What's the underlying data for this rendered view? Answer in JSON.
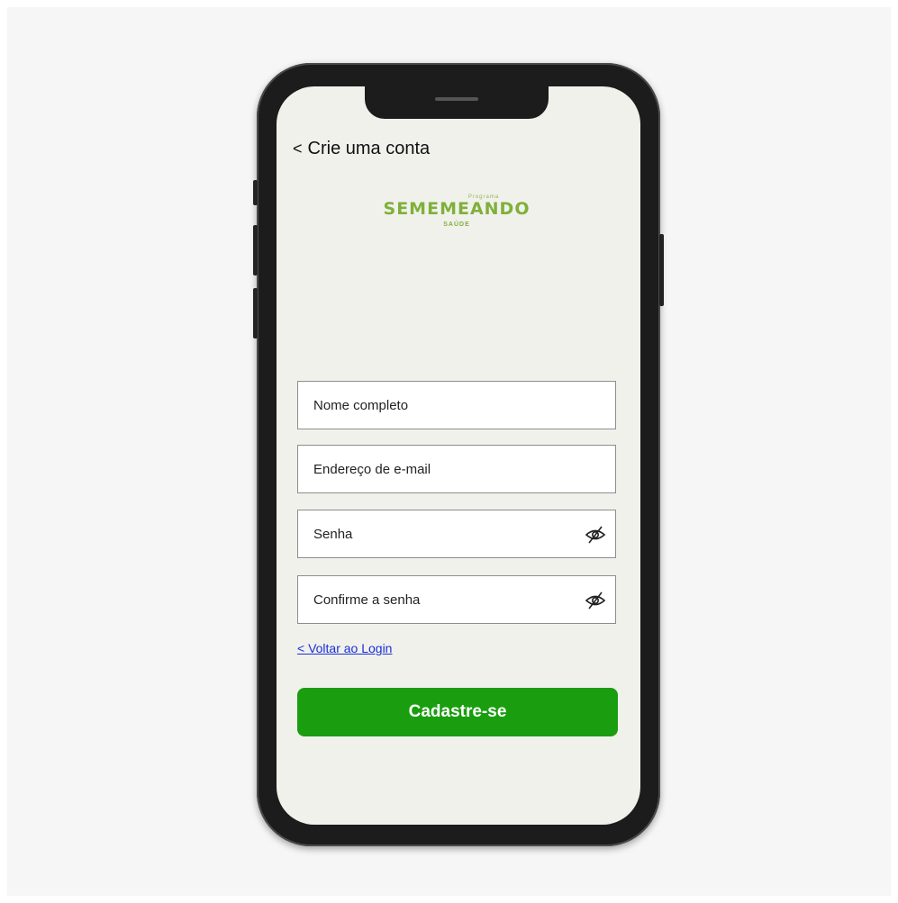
{
  "header": {
    "back_glyph": "<",
    "title": "Crie uma conta"
  },
  "logo": {
    "small_text": "Programa",
    "brand": "SEMEMEANDO",
    "subtitle": "SAÚDE",
    "color": "#7fb03a"
  },
  "form": {
    "full_name_placeholder": "Nome completo",
    "email_placeholder": "Endereço de e-mail",
    "password_placeholder": "Senha",
    "confirm_password_placeholder": "Confirme a senha",
    "password_toggle_icon": "eye-slash-icon",
    "back_to_login_label": "< Voltar ao Login",
    "submit_label": "Cadastre-se",
    "submit_color": "#1a9e0f"
  }
}
